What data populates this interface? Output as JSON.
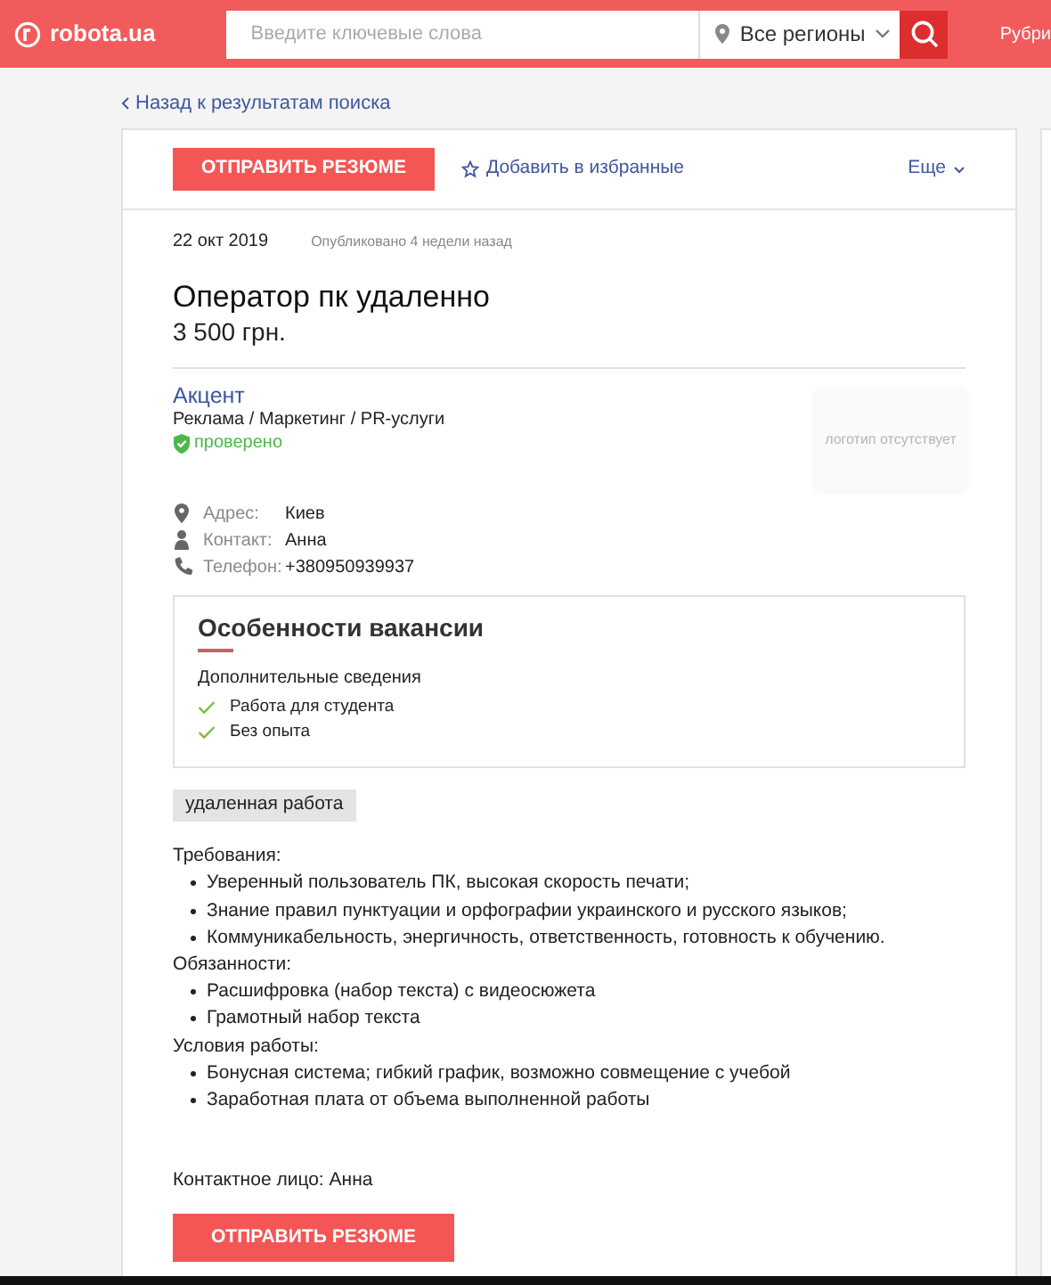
{
  "header": {
    "logo": "robota.ua",
    "search": {
      "placeholder": "Введите ключевые слова"
    },
    "region": "Все регионы",
    "nav_cut": "Рубри"
  },
  "back_link": "Назад к результатам поиска",
  "toolbar": {
    "apply": "ОТПРАВИТЬ РЕЗЮМЕ",
    "favorite": "Добавить в избранные",
    "more": "Еще"
  },
  "vacancy": {
    "date": "22 окт 2019",
    "published": "Опубликовано 4 недели назад",
    "title": "Оператор пк удаленно",
    "salary": "3 500 грн."
  },
  "company": {
    "name": "Акцент",
    "industry": "Реклама / Маркетинг / PR-услуги",
    "verified": true,
    "verified_label": "проверено",
    "logo_placeholder": "логотип отсутствует",
    "details": [
      {
        "kind": "address",
        "label": "Адрес:",
        "value": "Киев"
      },
      {
        "kind": "contact",
        "label": "Контакт:",
        "value": "Анна"
      },
      {
        "kind": "phone",
        "label": "Телефон:",
        "value": "+380950939937"
      }
    ]
  },
  "features": {
    "title": "Особенности вакансии",
    "subtitle": "Дополнительные сведения",
    "items": [
      "Работа для студента",
      "Без опыта"
    ]
  },
  "tags": [
    "удаленная работа"
  ],
  "description": [
    {
      "heading": "Требования:",
      "items": [
        "Уверенный пользователь ПК, высокая скорость печати;",
        "Знание правил пунктуации и орфографии украинского и русского языков;",
        "Коммуникабельность, энергичность, ответственность, готовность к обучению."
      ]
    },
    {
      "heading": "Обязанности:",
      "items": [
        "Расшифровка (набор текста) с видеосюжета",
        "Грамотный набор текста"
      ]
    },
    {
      "heading": "Условия работы:",
      "items": [
        "Бонусная система; гибкий график, возможно совмещение с учебой",
        "Заработная плата от объема выполненной работы"
      ]
    }
  ],
  "contact_person": "Контактное лицо: Анна",
  "bottom_apply": "ОТПРАВИТЬ РЕЗЮМЕ"
}
